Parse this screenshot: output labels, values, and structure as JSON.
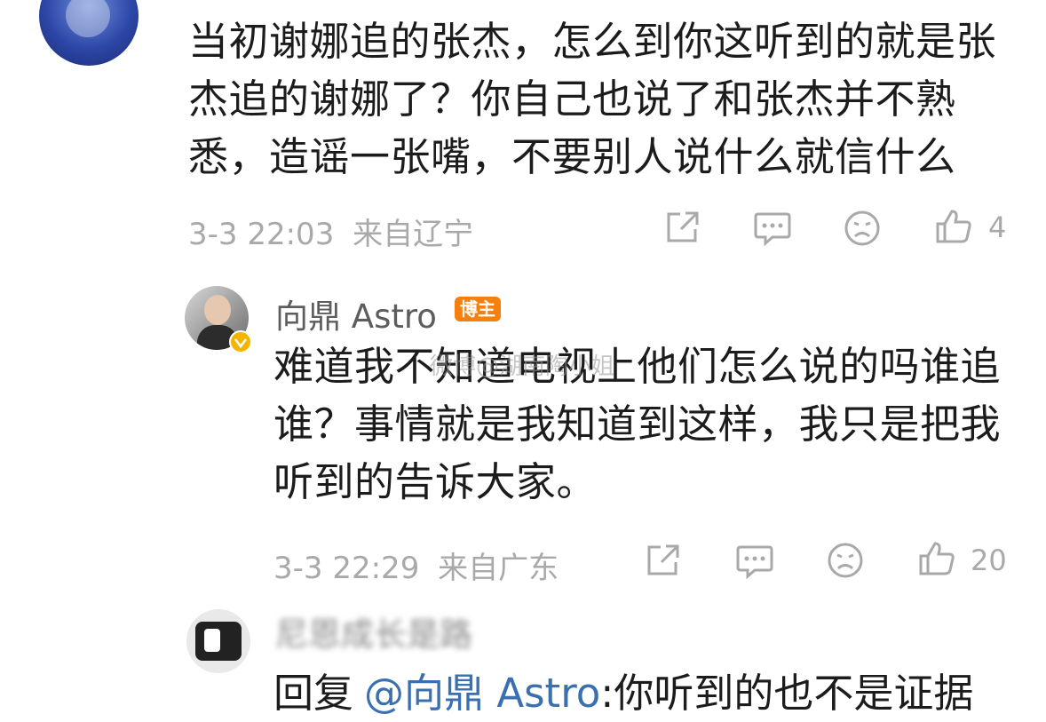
{
  "comment_1": {
    "text": "当初谢娜追的张杰，怎么到你这听到的就是张杰追的谢娜了？你自己也说了和张杰并不熟悉，造谣一张嘴，不要别人说什么就信什么",
    "time": "3-3 22:03",
    "location": "来自辽宁",
    "like_count": "4"
  },
  "reply_1": {
    "author": "向鼎 Astro",
    "badge": "博主",
    "text": "难道我不知道电视上他们怎么说的吗谁追谁？事情就是我知道到这样，我只是把我听到的告诉大家。",
    "time": "3-3 22:29",
    "location": "来自广东",
    "like_count": "20"
  },
  "reply_2": {
    "author": "尼恩成长是路",
    "reply_prefix": "回复",
    "mention": "@向鼎 Astro",
    "text": ":你听到的也不是证据"
  },
  "watermark": "微博@湖南陶小姐",
  "icons": {
    "share": "share-icon",
    "comment": "comment-icon",
    "dislike": "sad-face-icon",
    "like": "thumbs-up-icon",
    "verified": "verified-badge-icon"
  },
  "colors": {
    "meta_gray": "#a9a9a9",
    "badge_orange": "#f6800f",
    "mention_blue": "#3a6fb0",
    "verified_yellow": "#f5b400"
  }
}
